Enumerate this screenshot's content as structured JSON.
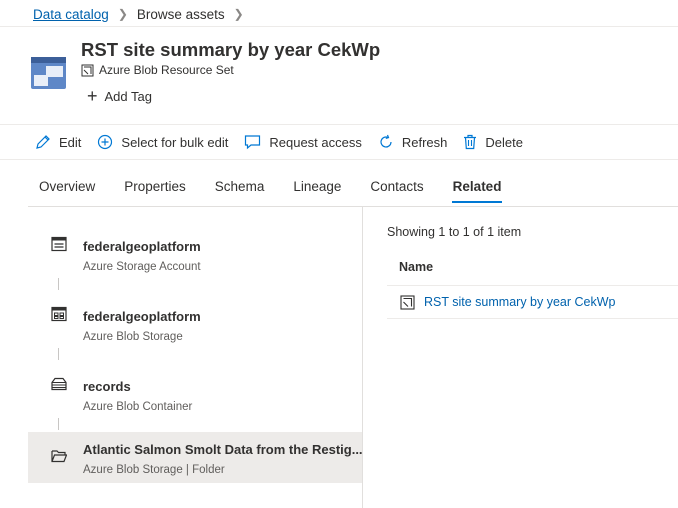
{
  "breadcrumb": {
    "root": "Data catalog",
    "current": "Browse assets"
  },
  "asset": {
    "title": "RST site summary by year CekWp",
    "type": "Azure Blob Resource Set",
    "add_tag_label": "Add Tag",
    "icon": "resource-set-icon"
  },
  "toolbar": {
    "edit": "Edit",
    "bulk_edit": "Select for bulk edit",
    "request_access": "Request access",
    "refresh": "Refresh",
    "delete": "Delete"
  },
  "tabs": [
    {
      "label": "Overview",
      "active": false
    },
    {
      "label": "Properties",
      "active": false
    },
    {
      "label": "Schema",
      "active": false
    },
    {
      "label": "Lineage",
      "active": false
    },
    {
      "label": "Contacts",
      "active": false
    },
    {
      "label": "Related",
      "active": true
    }
  ],
  "hierarchy": [
    {
      "name": "federalgeoplatform",
      "type": "Azure Storage Account",
      "icon": "storage-account-icon",
      "selected": false
    },
    {
      "name": "federalgeoplatform",
      "type": "Azure Blob Storage",
      "icon": "blob-storage-icon",
      "selected": false
    },
    {
      "name": "records",
      "type": "Azure Blob Container",
      "icon": "container-icon",
      "selected": false
    },
    {
      "name": "Atlantic Salmon Smolt Data from the Restig...",
      "type": "Azure Blob Storage | Folder",
      "icon": "folder-icon",
      "selected": true
    }
  ],
  "related": {
    "showing": "Showing 1 to 1 of 1 item",
    "column_name": "Name",
    "items": [
      {
        "name": "RST site summary by year CekWp",
        "icon": "resource-set-icon"
      }
    ]
  },
  "colors": {
    "link": "#0062ad",
    "accent": "#0078d4",
    "selected_bg": "#edebe9"
  }
}
